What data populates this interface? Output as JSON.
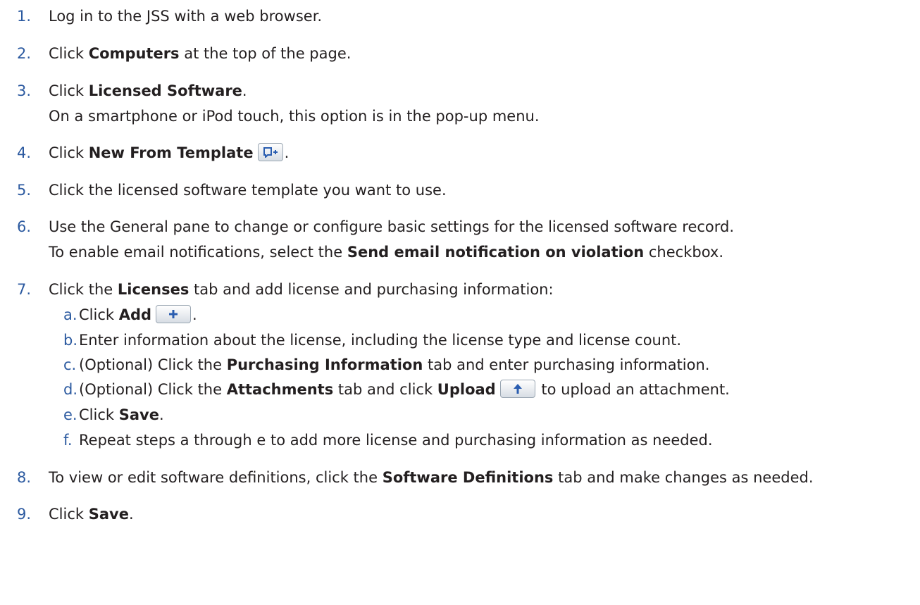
{
  "steps": [
    {
      "num": "1.",
      "text": "Log in to the JSS with a web browser."
    },
    {
      "num": "2.",
      "pre": "Click ",
      "bold": "Computers",
      "post": " at the top of the page."
    },
    {
      "num": "3.",
      "pre": "Click ",
      "bold": "Licensed Software",
      "post": ".",
      "note": "On a smartphone or iPod touch, this option is in the pop-up menu."
    },
    {
      "num": "4.",
      "pre": "Click ",
      "bold": "New From Template",
      "post": ".",
      "icon": "new-from-template-icon"
    },
    {
      "num": "5.",
      "text": "Click the licensed software template you want to use."
    },
    {
      "num": "6.",
      "text": "Use the General pane to change or configure basic settings for the licensed software record.",
      "note_pre": "To enable email notifications, select the ",
      "note_bold": "Send email notification on violation",
      "note_post": " checkbox."
    },
    {
      "num": "7.",
      "pre": "Click the ",
      "bold": "Licenses",
      "post": " tab and add license and purchasing information:",
      "substeps": [
        {
          "num": "a.",
          "pre": "Click ",
          "bold": "Add",
          "post": ".",
          "icon": "add-icon"
        },
        {
          "num": "b.",
          "text": "Enter information about the license, including the license type and license count."
        },
        {
          "num": "c.",
          "pre": "(Optional) Click the ",
          "bold": "Purchasing Information",
          "post": " tab and enter purchasing information."
        },
        {
          "num": "d.",
          "pre": "(Optional) Click the ",
          "bold": "Attachments",
          "mid": " tab and click ",
          "bold2": "Upload",
          "post": " to upload an attachment.",
          "icon": "upload-icon"
        },
        {
          "num": "e.",
          "pre": "Click ",
          "bold": "Save",
          "post": "."
        },
        {
          "num": "f.",
          "text": "Repeat steps a through e to add more license and purchasing information as needed."
        }
      ]
    },
    {
      "num": "8.",
      "pre": "To view or edit software definitions, click the ",
      "bold": "Software Definitions",
      "post": " tab and make changes as needed."
    },
    {
      "num": "9.",
      "pre": "Click ",
      "bold": "Save",
      "post": "."
    }
  ],
  "colors": {
    "step_number": "#2c5aa0",
    "text": "#231f20",
    "icon": "#2a5db0"
  }
}
